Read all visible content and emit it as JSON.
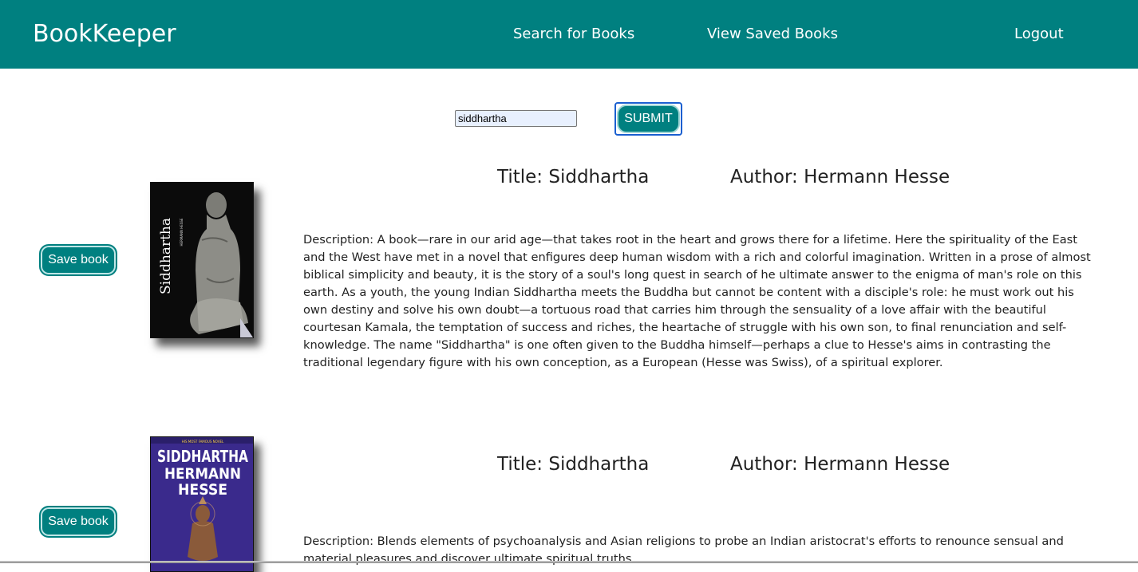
{
  "navbar": {
    "brand": "BookKeeper",
    "search_link": "Search for Books",
    "saved_link": "View Saved Books",
    "logout_link": "Logout",
    "color": "#008080"
  },
  "search": {
    "value": "siddhartha",
    "submit_label": "SUBMIT"
  },
  "books": [
    {
      "save_label": "Save book",
      "title": "Title: Siddhartha",
      "author": "Author: Hermann Hesse",
      "cover_title": "Siddhartha",
      "cover_author": "HERMANN HESSE",
      "description": "Description: A book—rare in our arid age—that takes root in the heart and grows there for a lifetime. Here the spirituality of the East and the West have met in a novel that enfigures deep human wisdom with a rich and colorful imagination. Written in a prose of almost biblical simplicity and beauty, it is the story of a soul's long quest in search of he ultimate answer to the enigma of man's role on this earth. As a youth, the young Indian Siddhartha meets the Buddha but cannot be content with a disciple's role: he must work out his own destiny and solve his own doubt—a tortuous road that carries him through the sensuality of a love affair with the beautiful courtesan Kamala, the temptation of success and riches, the heartache of struggle with his own son, to final renunciation and self-knowledge. The name \"Siddhartha\" is one often given to the Buddha himself—perhaps a clue to Hesse's aims in contrasting the traditional legendary figure with his own conception, as a European (Hesse was Swiss), of a spiritual explorer."
    },
    {
      "save_label": "Save book",
      "title": "Title: Siddhartha",
      "author": "Author: Hermann Hesse",
      "cover_kicker": "HIS MOST FAMOUS NOVEL",
      "cover_title": "SIDDHARTHA",
      "cover_author_line1": "HERMANN",
      "cover_author_line2": "HESSE",
      "description": "Description: Blends elements of psychoanalysis and Asian religions to probe an Indian aristocrat's efforts to renounce sensual and material pleasures and discover ultimate spiritual truths."
    }
  ]
}
